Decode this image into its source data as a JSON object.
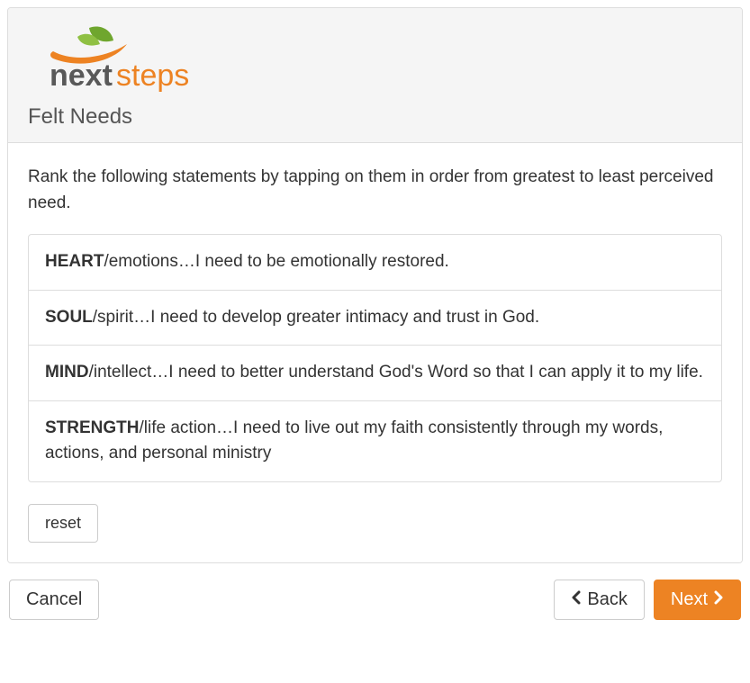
{
  "header": {
    "logo_text_next": "next",
    "logo_text_steps": "steps",
    "title": "Felt Needs"
  },
  "body": {
    "instructions": "Rank the following statements by tapping on them in order from greatest to least perceived need.",
    "items": [
      {
        "bold": "HEART",
        "rest": "/emotions…I need to be emotionally restored."
      },
      {
        "bold": "SOUL",
        "rest": "/spirit…I need to develop greater intimacy and trust in God."
      },
      {
        "bold": "MIND",
        "rest": "/intellect…I need to better understand God's Word so that I can apply it to my life."
      },
      {
        "bold": "STRENGTH",
        "rest": "/life action…I need to live out my faith consistently through my words, actions, and personal ministry"
      }
    ],
    "reset_label": "reset"
  },
  "footer": {
    "cancel_label": "Cancel",
    "back_label": "Back",
    "next_label": "Next"
  }
}
